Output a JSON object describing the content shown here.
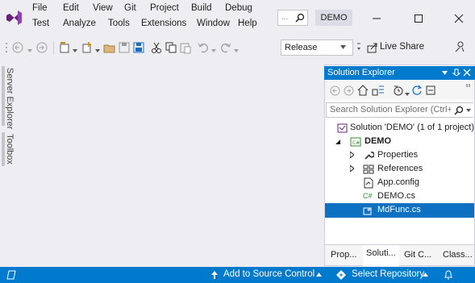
{
  "menu": {
    "row1": [
      "File",
      "Edit",
      "View",
      "Git",
      "Project",
      "Build",
      "Debug"
    ],
    "row2": [
      "Test",
      "Analyze",
      "Tools",
      "Extensions",
      "Window",
      "Help"
    ]
  },
  "search": {
    "placeholder": "..."
  },
  "solution_badge": "DEMO",
  "toolbar": {
    "configuration": "Release",
    "live_share": "Live Share"
  },
  "side_tabs": [
    "Server Explorer",
    "Toolbox"
  ],
  "solution_explorer": {
    "title": "Solution Explorer",
    "search_placeholder": "Search Solution Explorer (Ctrl+;",
    "tree": [
      {
        "label": "Solution 'DEMO' (1 of 1 project)",
        "icon": "solution-icon",
        "level": 0
      },
      {
        "label": "DEMO",
        "icon": "csharp-project-icon",
        "level": 1,
        "expanded": true
      },
      {
        "label": "Properties",
        "icon": "wrench-icon",
        "level": 2
      },
      {
        "label": "References",
        "icon": "references-icon",
        "level": 2
      },
      {
        "label": "App.config",
        "icon": "config-file-icon",
        "level": 2
      },
      {
        "label": "DEMO.cs",
        "icon": "csharp-file-icon",
        "level": 2
      },
      {
        "label": "MdFunc.cs",
        "icon": "csharp-file-icon",
        "level": 2,
        "selected": true
      }
    ],
    "tabs": [
      "Prop...",
      "Soluti...",
      "Git C...",
      "Class..."
    ]
  },
  "status_bar": {
    "source_control": "Add to Source Control",
    "repository": "Select Repository"
  },
  "colors": {
    "accent": "#007acc",
    "selection": "#0e70c0",
    "chrome": "#eeeef2"
  }
}
